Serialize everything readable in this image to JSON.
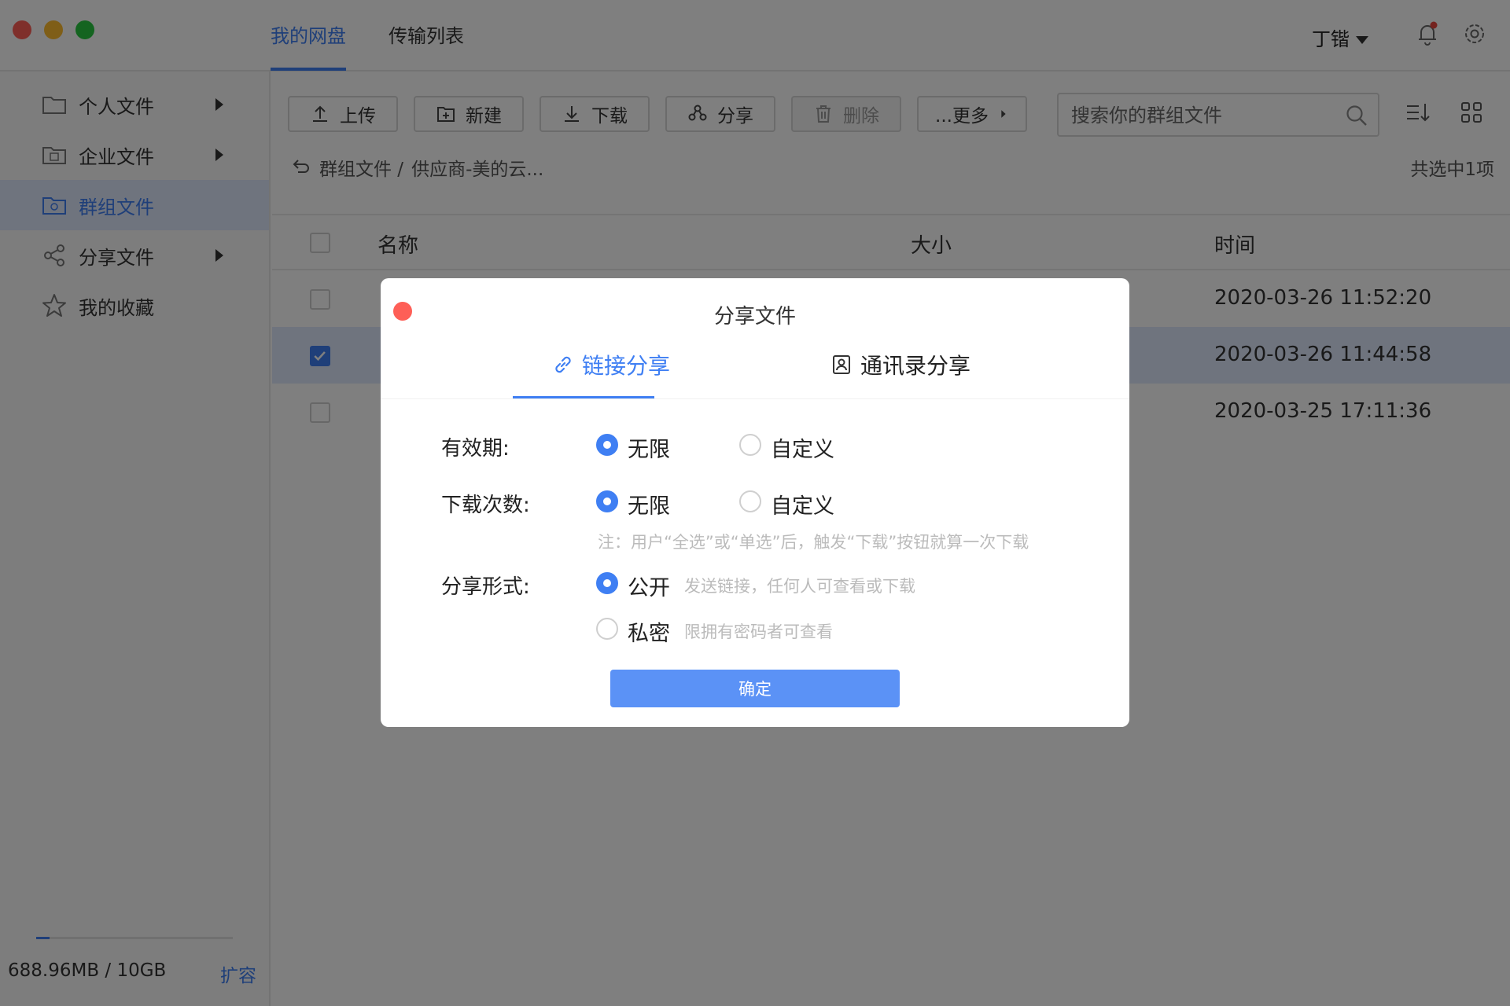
{
  "window": {
    "tabs": [
      {
        "label": "我的网盘",
        "active": true
      },
      {
        "label": "传输列表",
        "active": false
      }
    ],
    "user_name": "丁锴",
    "notification_icon": "bell-icon",
    "settings_icon": "gear-icon",
    "colors": {
      "accent": "#3f7ff3",
      "notification_dot": "#e8473f"
    }
  },
  "sidebar": {
    "items": [
      {
        "label": "个人文件",
        "icon": "folder-icon",
        "has_arrow": true,
        "active": false
      },
      {
        "label": "企业文件",
        "icon": "enterprise-folder-icon",
        "has_arrow": true,
        "active": false
      },
      {
        "label": "群组文件",
        "icon": "group-folder-icon",
        "has_arrow": false,
        "active": true
      },
      {
        "label": "分享文件",
        "icon": "share-icon",
        "has_arrow": true,
        "active": false
      },
      {
        "label": "我的收藏",
        "icon": "star-icon",
        "has_arrow": false,
        "active": false
      }
    ],
    "storage": {
      "used_text": "688.96MB / 10GB",
      "fill_fraction": 0.067,
      "expand_label": "扩容"
    }
  },
  "toolbar": {
    "buttons": [
      {
        "label": "上传",
        "icon": "upload-icon",
        "disabled": false
      },
      {
        "label": "新建",
        "icon": "new-folder-icon",
        "disabled": false
      },
      {
        "label": "下载",
        "icon": "download-icon",
        "disabled": false
      },
      {
        "label": "分享",
        "icon": "share-icon",
        "disabled": false
      },
      {
        "label": "删除",
        "icon": "trash-icon",
        "disabled": true
      },
      {
        "label": "...更多",
        "icon": "caret-right-icon",
        "disabled": false
      }
    ],
    "search_placeholder": "搜索你的群组文件",
    "sort_icon": "sort-icon",
    "grid_icon": "grid-view-icon"
  },
  "breadcrumb": {
    "back_icon": "back-arrow-icon",
    "root": "群组文件 /",
    "current": "供应商-美的云..."
  },
  "selected_count": "共选中1项",
  "table": {
    "headers": {
      "name": "名称",
      "size": "大小",
      "time": "时间"
    },
    "rows": [
      {
        "time": "2020-03-26 11:52:20",
        "checked": false
      },
      {
        "time": "2020-03-26 11:44:58",
        "checked": true
      },
      {
        "time": "2020-03-25 17:11:36",
        "checked": false
      }
    ]
  },
  "modal": {
    "title": "分享文件",
    "tabs": [
      {
        "label": "链接分享",
        "icon": "link-icon",
        "active": true
      },
      {
        "label": "通讯录分享",
        "icon": "contacts-icon",
        "active": false
      }
    ],
    "validity": {
      "label": "有效期:",
      "options": [
        "无限",
        "自定义"
      ],
      "selected": "无限"
    },
    "download_count": {
      "label": "下载次数:",
      "options": [
        "无限",
        "自定义"
      ],
      "selected": "无限",
      "note": "注：用户“全选”或“单选”后，触发“下载”按钮就算一次下载"
    },
    "share_form": {
      "label": "分享形式:",
      "options": [
        {
          "label": "公开",
          "hint": "发送链接，任何人可查看或下载",
          "selected": true
        },
        {
          "label": "私密",
          "hint": "限拥有密码者可查看",
          "selected": false
        }
      ]
    },
    "confirm_label": "确定",
    "confirm_color": "#5b92f6"
  }
}
